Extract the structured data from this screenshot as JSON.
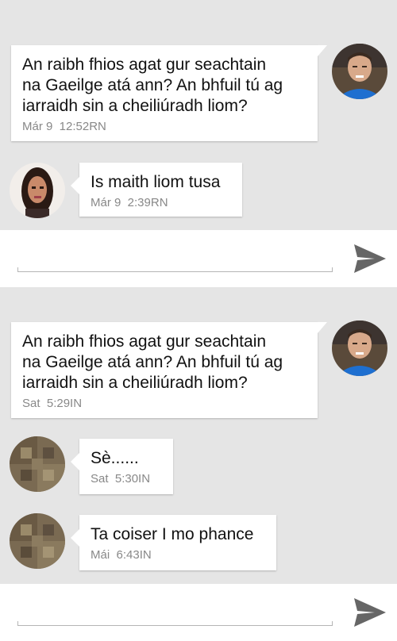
{
  "conversations": [
    {
      "messages": [
        {
          "direction": "outgoing",
          "text": "An raibh fhios agat gur seachtain\nna Gaeilge atá ann? An bhfuil tú ag\niarraidh sin a cheiliúradh liom?",
          "time": "Már 9  12:52RN"
        },
        {
          "direction": "incoming",
          "text": "Is maith liom tusa",
          "time": "Már 9  2:39RN"
        }
      ],
      "composer": {
        "value": "",
        "placeholder": ""
      }
    },
    {
      "messages": [
        {
          "direction": "outgoing",
          "text": "An raibh fhios agat gur seachtain\nna Gaeilge atá ann? An bhfuil tú ag\niarraidh sin a cheiliúradh liom?",
          "time": "Sat  5:29IN"
        },
        {
          "direction": "incoming",
          "text": "Sè......",
          "time": "Sat  5:30IN"
        },
        {
          "direction": "incoming",
          "text": "Ta coiser I mo phance",
          "time": "Mái  6:43IN"
        }
      ],
      "composer": {
        "value": "",
        "placeholder": ""
      }
    }
  ],
  "icons": {
    "send": "send-icon",
    "avatar_self": "avatar-icon",
    "avatar_contact": "avatar-icon"
  },
  "colors": {
    "background": "#e5e5e5",
    "bubble": "#ffffff",
    "timestamp": "#888888",
    "send_icon": "#666666"
  }
}
